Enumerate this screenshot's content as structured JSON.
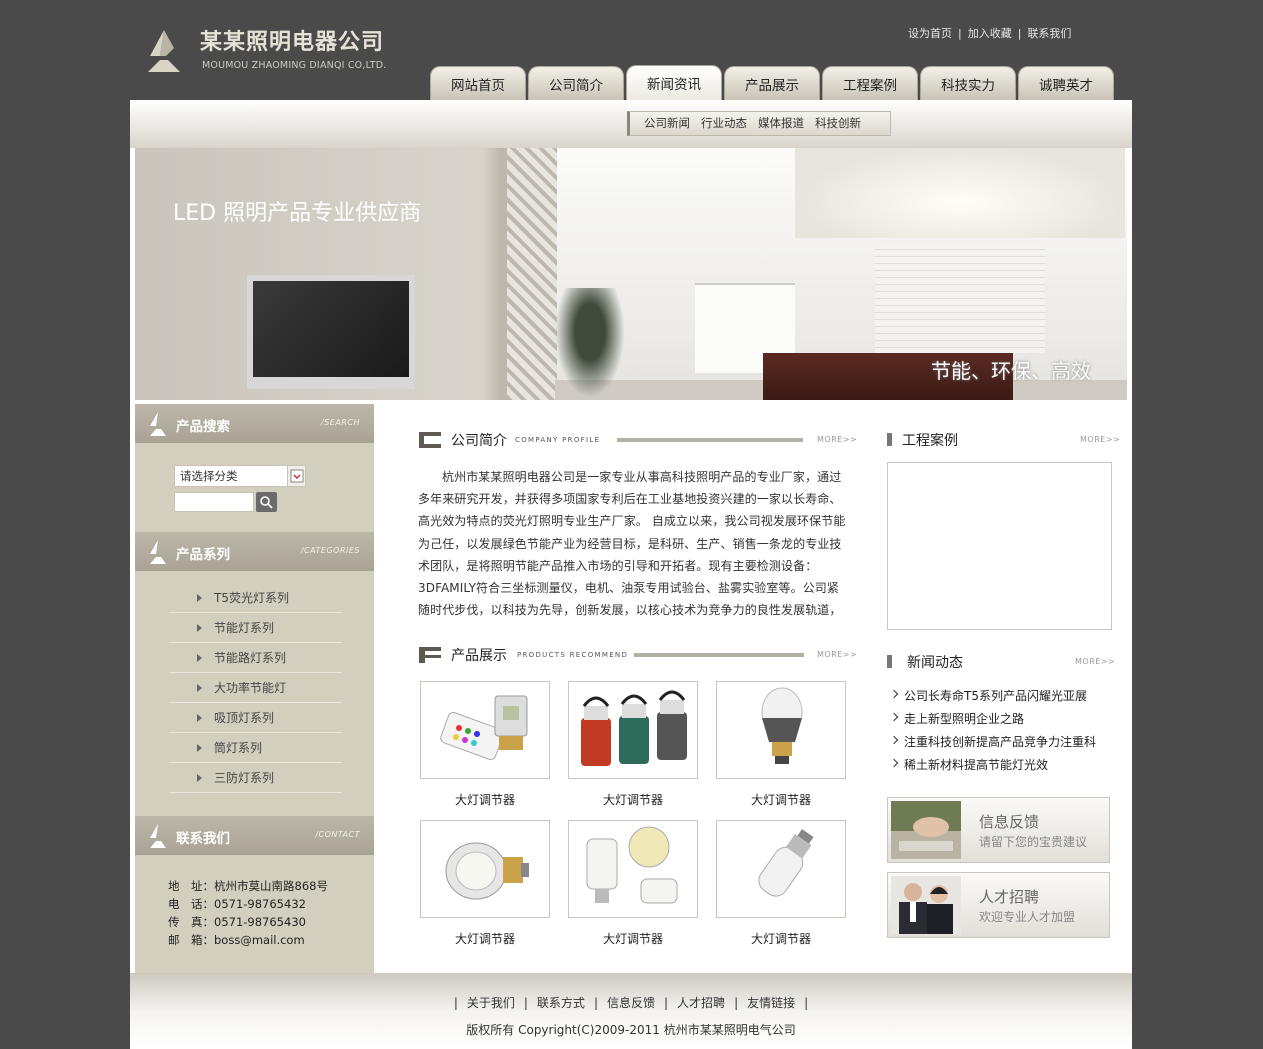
{
  "brand": {
    "name_cn": "某某照明电器公司",
    "name_en": "MOUMOU ZHAOMING DIANQI CO,LTD."
  },
  "top_links": [
    "设为首页",
    "加入收藏",
    "联系我们"
  ],
  "nav": {
    "items": [
      "网站首页",
      "公司简介",
      "新闻资讯",
      "产品展示",
      "工程案例",
      "科技实力",
      "诚聘英才"
    ],
    "active": "新闻资讯",
    "sub_items": [
      "公司新闻",
      "行业动态",
      "媒体报道",
      "科技创新"
    ]
  },
  "banner": {
    "headline": "LED 照明产品专业供应商",
    "tagline": "节能、环保、高效"
  },
  "search": {
    "title": "产品搜索",
    "title_en": "/SEARCH",
    "category_placeholder": "请选择分类"
  },
  "categories": {
    "title": "产品系列",
    "title_en": "/CATEGORIES",
    "items": [
      "T5荧光灯系列",
      "节能灯系列",
      "节能路灯系列",
      "大功率节能灯",
      "吸顶灯系列",
      "筒灯系列",
      "三防灯系列"
    ]
  },
  "contact": {
    "title": "联系我们",
    "title_en": "/CONTACT",
    "lines": [
      "地　址：杭州市莫山南路868号",
      "电　话：0571-98765432",
      "传　真：0571-98765430",
      "邮　箱：boss@mail.com"
    ]
  },
  "profile": {
    "title": "公司简介",
    "title_en": "COMPANY PROFILE",
    "more": "MORE>>",
    "text": "杭州市某某照明电器公司是一家专业从事高科技照明产品的专业厂家，通过多年来研究开发，并获得多项国家专利后在工业基地投资兴建的一家以长寿命、高光效为特点的荧光灯照明专业生产厂家。 自成立以来，我公司视发展环保节能为己任，以发展绿色节能产业为经营目标，是科研、生产、销售一条龙的专业技术团队，是将照明节能产品推入市场的引导和开拓者。现有主要检测设备：3DFAMILY符合三坐标测量仪，电机、油泵专用试验台、盐雾实验室等。公司紧随时代步伐，以科技为先导，创新发展，以核心技术为竞争力的良性发展轨道，以科学管理为后盾"
  },
  "products": {
    "title": "产品展示",
    "title_en": "PRODUCTS RECOMMEND",
    "more": "MORE>>",
    "items": [
      "大灯调节器",
      "大灯调节器",
      "大灯调节器",
      "大灯调节器",
      "大灯调节器",
      "大灯调节器"
    ]
  },
  "cases": {
    "title": "工程案例",
    "more": "MORE>>"
  },
  "news": {
    "title": "新闻动态",
    "more": "MORE>>",
    "items": [
      "公司长寿命T5系列产品闪耀光亚展",
      "走上新型照明企业之路",
      "注重科技创新提高产品竞争力注重科",
      "稀土新材料提高节能灯光效"
    ]
  },
  "promos": [
    {
      "title": "信息反馈",
      "subtitle": "请留下您的宝贵建议"
    },
    {
      "title": "人才招聘",
      "subtitle": "欢迎专业人才加盟"
    }
  ],
  "footer": {
    "links": [
      "关于我们",
      "联系方式",
      "信息反馈",
      "人才招聘",
      "友情链接"
    ],
    "copyright": "版权所有 Copyright(C)2009-2011 杭州市某某照明电气公司"
  },
  "colors": {
    "page_bg": "#4a4a4a",
    "sidebar_bg": "#d3cfbf",
    "header_band": "#a8a394"
  }
}
